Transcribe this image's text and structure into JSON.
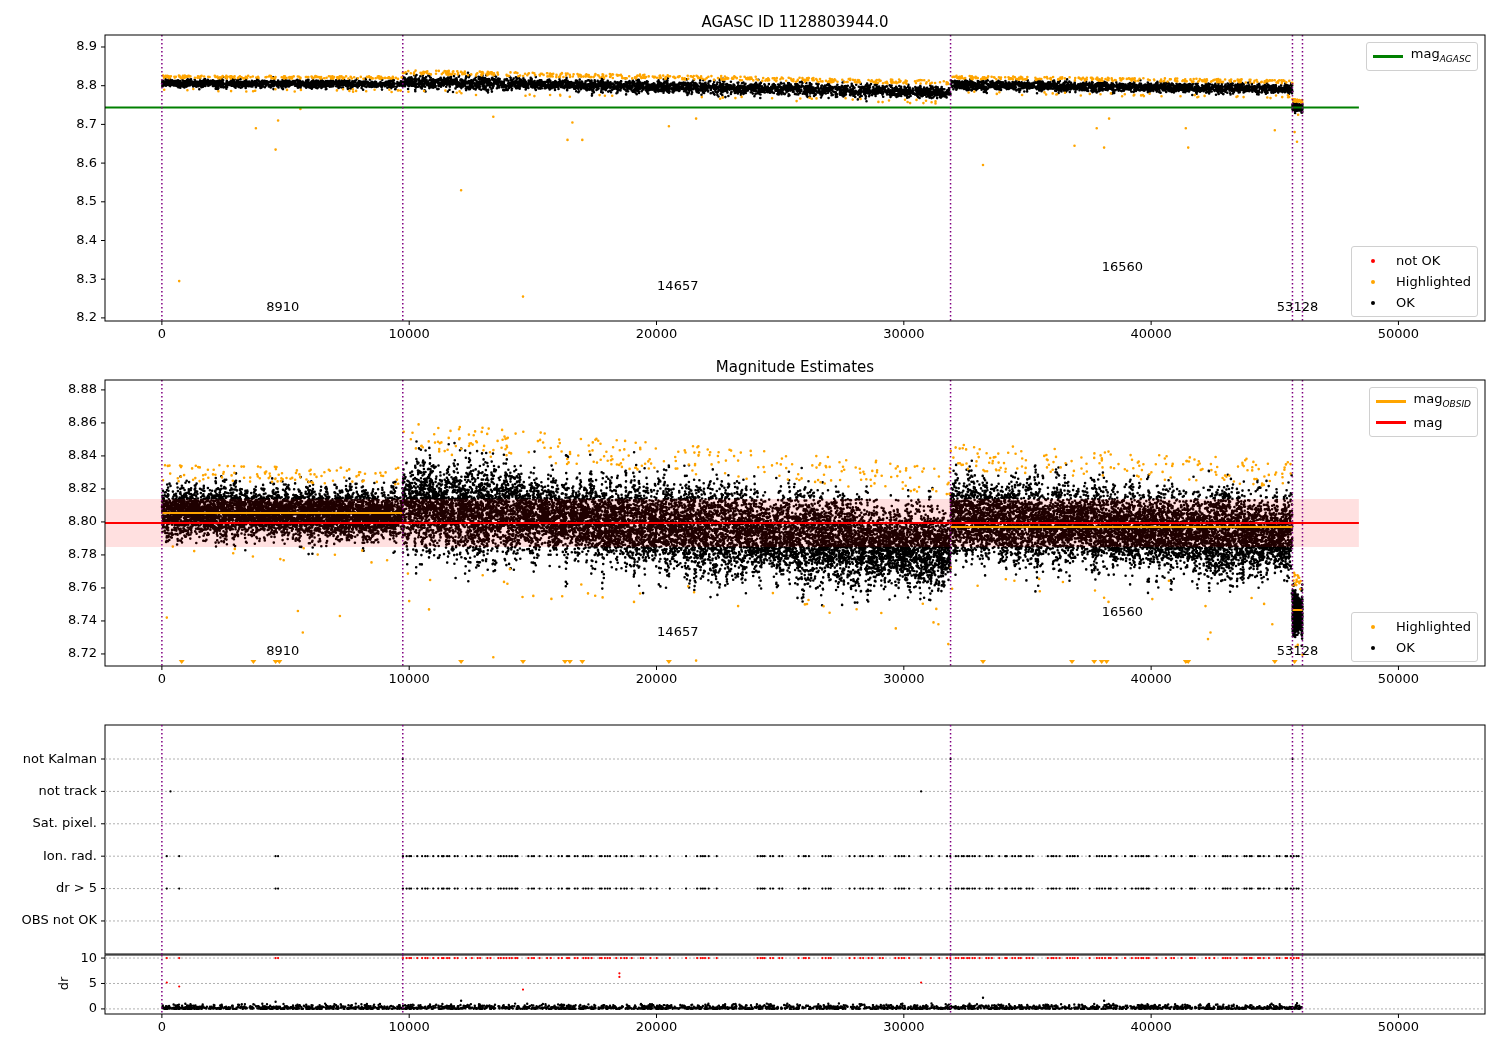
{
  "panels": [
    {
      "kind": "magnitude",
      "legend": {
        "entries": [
          {
            "kind": "dot",
            "label": "not OK",
            "color": "#ff0000"
          },
          {
            "kind": "dot",
            "label": "Highlighted",
            "color": "#ffa500"
          },
          {
            "kind": "dot",
            "label": "OK",
            "color": "#000000"
          }
        ]
      },
      "chart_data": {
        "type": "scatter",
        "title": "AGASC ID 1128803944.0",
        "xlim": [
          -2300,
          53500
        ],
        "ylim": [
          8.192,
          8.931
        ],
        "xticks": [
          0,
          10000,
          20000,
          30000,
          40000,
          50000
        ],
        "yticks": [
          8.2,
          8.3,
          8.4,
          8.5,
          8.6,
          8.7,
          8.8,
          8.9
        ],
        "series": [
          {
            "name": "mag$_{AGASC}$",
            "type": "line",
            "color": "#008000",
            "x": [
              -2300,
              48400
            ],
            "values": [
              8.744,
              8.744
            ]
          }
        ],
        "ref_lines": [
          {
            "axis": "x",
            "value": 0
          },
          {
            "axis": "x",
            "value": 9741
          },
          {
            "axis": "x",
            "value": 31890
          },
          {
            "axis": "x",
            "value": 45715
          },
          {
            "axis": "x",
            "value": 46120
          }
        ],
        "annotations": [
          "8910",
          "14657",
          "16560",
          "53128"
        ]
      }
    },
    {
      "kind": "magnitude",
      "legend": {
        "entries": [
          {
            "kind": "dot",
            "label": "Highlighted",
            "color": "#ffa500"
          },
          {
            "kind": "dot",
            "label": "OK",
            "color": "#000000"
          }
        ]
      },
      "chart_data": {
        "type": "scatter",
        "title": "Magnitude Estimates",
        "xlim": [
          -2300,
          53500
        ],
        "ylim": [
          8.7127,
          8.886
        ],
        "xticks": [
          0,
          10000,
          20000,
          30000,
          40000,
          50000
        ],
        "yticks": [
          {
            "value": 8.72,
            "label": "8.72"
          },
          {
            "value": 8.74,
            "label": "8.74"
          },
          {
            "value": 8.76,
            "label": "8.76"
          },
          {
            "value": 8.78,
            "label": "8.78"
          },
          {
            "value": 8.8,
            "label": "8.80"
          },
          {
            "value": 8.82,
            "label": "8.82"
          },
          {
            "value": 8.84,
            "label": "8.84"
          },
          {
            "value": 8.86,
            "label": "8.86"
          },
          {
            "value": 8.88,
            "label": "8.88"
          }
        ],
        "series": [
          {
            "name": "mag$_{OBSID}$",
            "type": "line",
            "color": "#ffa500",
            "x": [
              0,
              9741,
              null,
              9741,
              31890,
              null,
              31890,
              45715,
              null,
              45715,
              46120
            ],
            "values": [
              8.8054,
              8.8054,
              null,
              8.7993,
              8.7993,
              null,
              8.797,
              8.797,
              null,
              8.7466,
              8.7466
            ]
          },
          {
            "name": "mag",
            "type": "line",
            "color": "#ff0000",
            "x": [
              -2300,
              48400
            ],
            "values": [
              8.7993,
              8.7993
            ]
          }
        ],
        "bands": [
          {
            "axis": "y",
            "from": 8.7848,
            "to": 8.8139
          }
        ],
        "ref_lines": [
          {
            "axis": "x",
            "value": 0
          },
          {
            "axis": "x",
            "value": 9741
          },
          {
            "axis": "x",
            "value": 31890
          },
          {
            "axis": "x",
            "value": 45715
          },
          {
            "axis": "x",
            "value": 46120
          }
        ],
        "annotations": [
          "8910",
          "14657",
          "16560",
          "53128"
        ]
      }
    },
    {
      "kind": "flags",
      "chart_data": {
        "type": "scatter",
        "orientation": "horizontal",
        "grid": true,
        "xlim": [
          -2300,
          53500
        ],
        "categories": [
          "not Kalman",
          "not track",
          "Sat. pixel.",
          "Ion. rad.",
          "dr > 5",
          "OBS not OK"
        ],
        "ref_lines": [
          {
            "axis": "x",
            "value": 0
          },
          {
            "axis": "x",
            "value": 9741
          },
          {
            "axis": "x",
            "value": 31890
          },
          {
            "axis": "x",
            "value": 45715
          },
          {
            "axis": "x",
            "value": 46120
          }
        ]
      }
    },
    {
      "kind": "dr",
      "chart_data": {
        "type": "scatter",
        "grid": true,
        "ylabel": "dr",
        "xlim": [
          -2300,
          53500
        ],
        "ylim": [
          -1,
          10.6
        ],
        "xticks": [
          0,
          10000,
          20000,
          30000,
          40000,
          50000
        ],
        "yticks": [
          0,
          5,
          10
        ],
        "ref_lines": [
          {
            "axis": "x",
            "value": 0
          },
          {
            "axis": "x",
            "value": 9741
          },
          {
            "axis": "x",
            "value": 31890
          },
          {
            "axis": "x",
            "value": 45715
          },
          {
            "axis": "x",
            "value": 46120
          }
        ]
      }
    }
  ]
}
